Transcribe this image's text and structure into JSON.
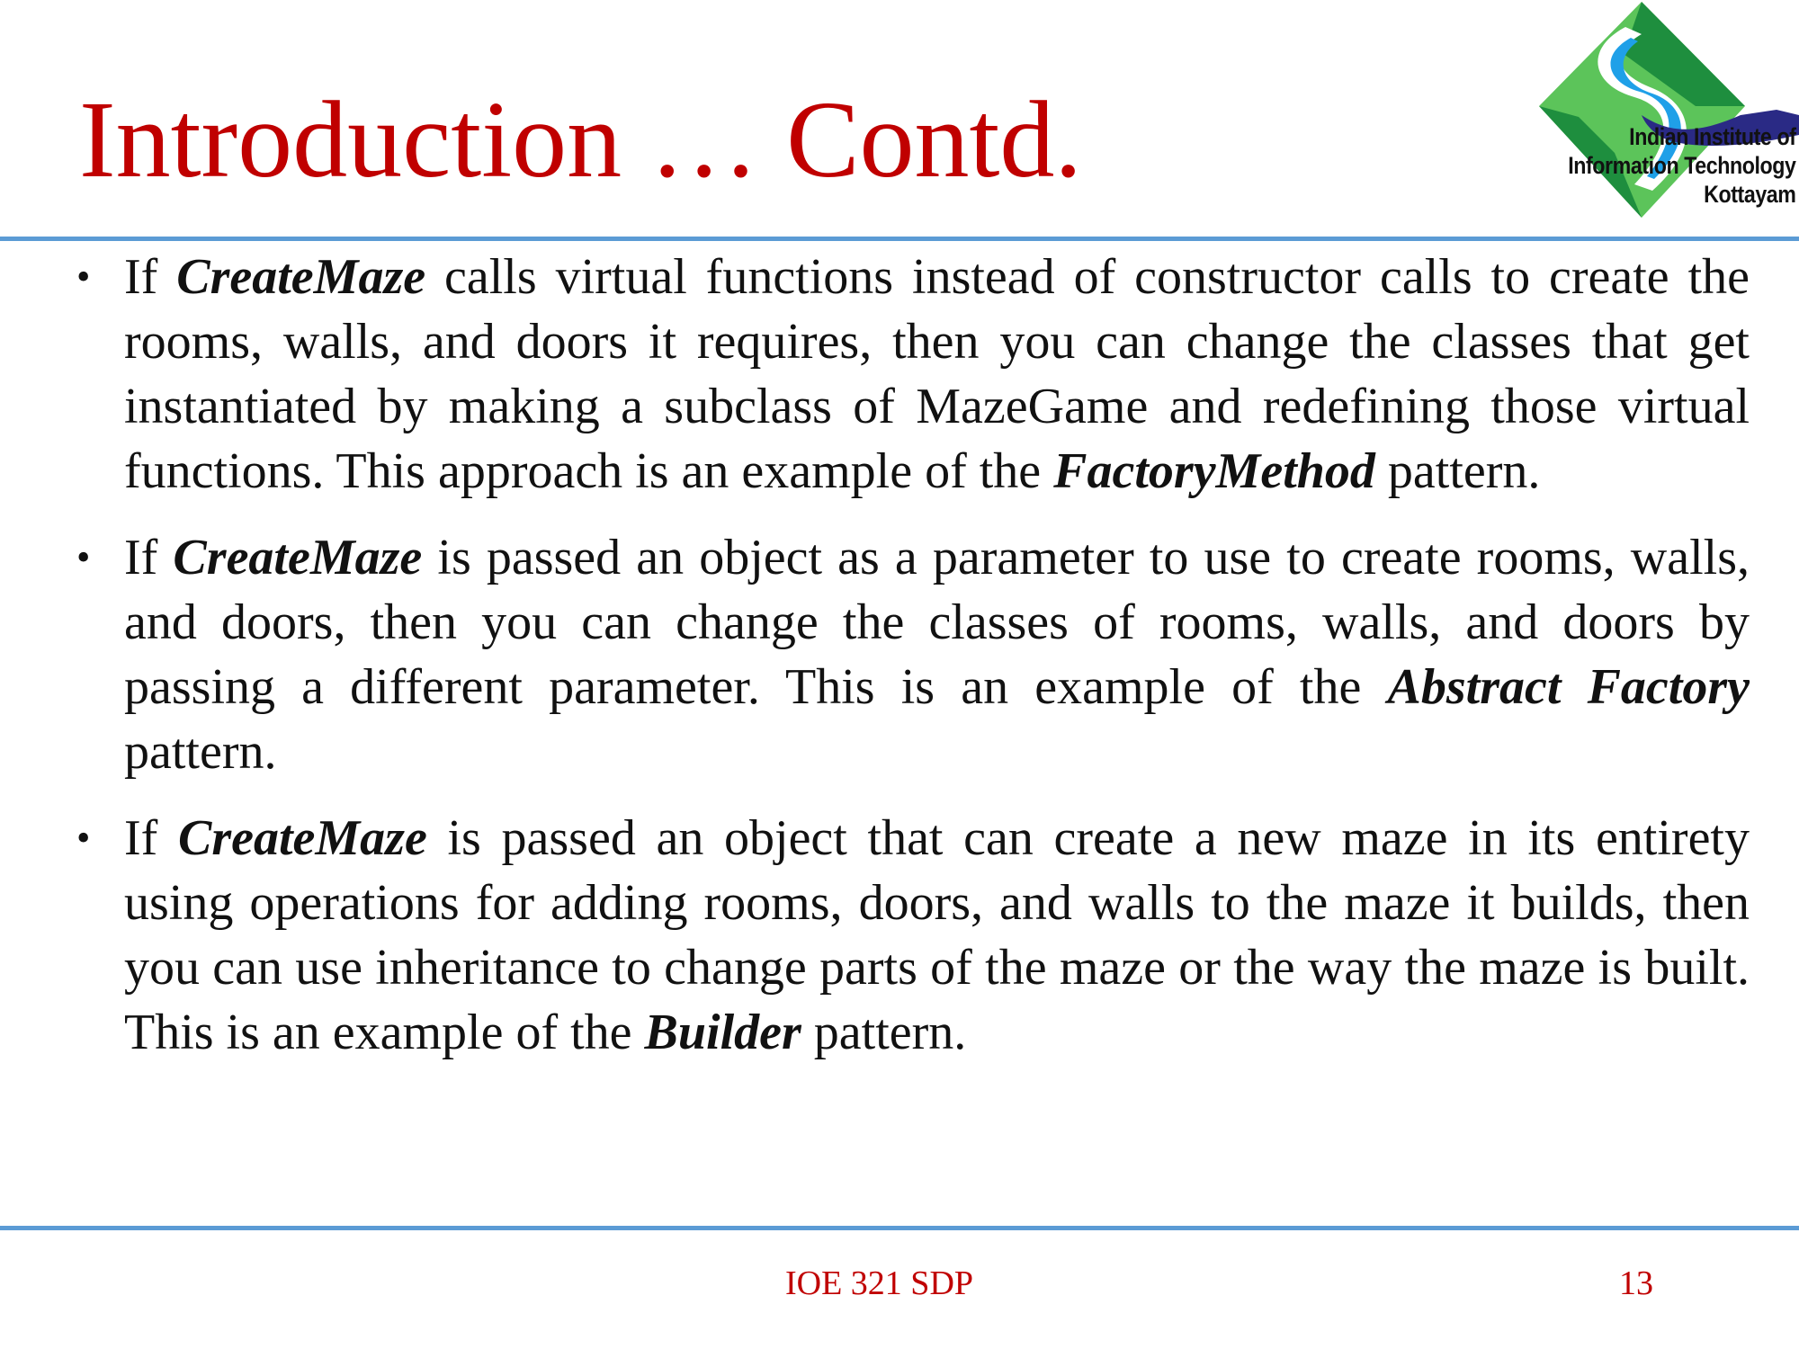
{
  "slide": {
    "title": "Introduction  … Contd.",
    "logo": {
      "line1": "Indian Institute of",
      "line2": "Information Technology",
      "line3": "Kottayam",
      "colors": {
        "green_dark": "#1E8E3E",
        "green_light": "#5CC45A",
        "blue": "#1FA0E8",
        "navy": "#2A2A85",
        "white": "#FFFFFF"
      }
    },
    "bullets": [
      {
        "marker": "•",
        "before": "If  ",
        "emphasis": "CreateMaze",
        "after": " calls virtual functions instead of  constructor calls to create the rooms, walls, and doors it requires, then you can change the classes that get instantiated by making a subclass of MazeGame and redefining those virtual functions. This approach is an example of  the ",
        "emphasis2": "FactoryMethod",
        "after2": " pattern."
      },
      {
        "marker": "•",
        "before": "If  ",
        "emphasis": "CreateMaze",
        "after": " is passed an object as a parameter to use to create rooms, walls, and doors, then you can change the classes of  rooms, walls, and doors by passing a different parameter. This is an example of  the ",
        "emphasis2": "Abstract Factory",
        "after2": " pattern."
      },
      {
        "marker": "•",
        "before": "If  ",
        "emphasis": "CreateMaze",
        "after": " is passed an object that can create a new maze in its entirety using operations for adding rooms, doors, and walls to the maze it builds, then you can use inheritance to change parts of the maze or the way the maze is built. This is an example of  the ",
        "emphasis2": "Builder",
        "after2": " pattern."
      }
    ],
    "footer": {
      "course": "IOE 321 SDP",
      "page": "13"
    },
    "colors": {
      "title": "#C00000",
      "rule": "#5B9BD5",
      "footer": "#C00000",
      "body_text": "#111111"
    }
  }
}
